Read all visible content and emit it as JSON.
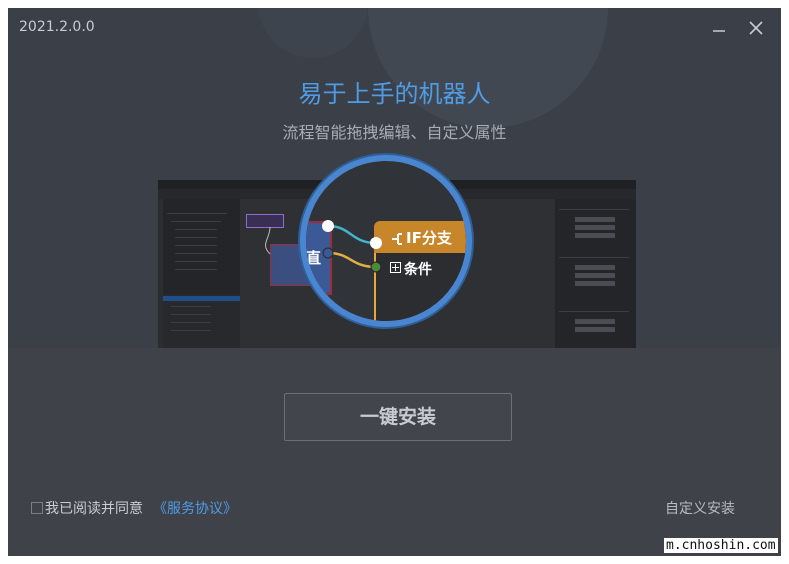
{
  "window": {
    "version": "2021.2.0.0",
    "minimize_icon": "minimize-icon",
    "close_icon": "close-icon"
  },
  "banner": {
    "title": "易于上手的机器人",
    "subtitle": "流程智能拖拽编辑、自定义属性"
  },
  "preview": {
    "if_label": "IF分支",
    "condition_label": "条件",
    "cut_label": "直",
    "icons": [
      "if-branch-icon",
      "condition-plus-icon"
    ]
  },
  "actions": {
    "install_label": "一键安装",
    "agree_text": "我已阅读并同意",
    "terms_link": "《服务协议》",
    "custom_install": "自定义安装"
  },
  "watermark": "m.cnhoshin.com",
  "colors": {
    "accent": "#4f9ce6",
    "lens_ring": "#4a86cf",
    "if_block": "#c8862a",
    "background": "#3f4248"
  }
}
